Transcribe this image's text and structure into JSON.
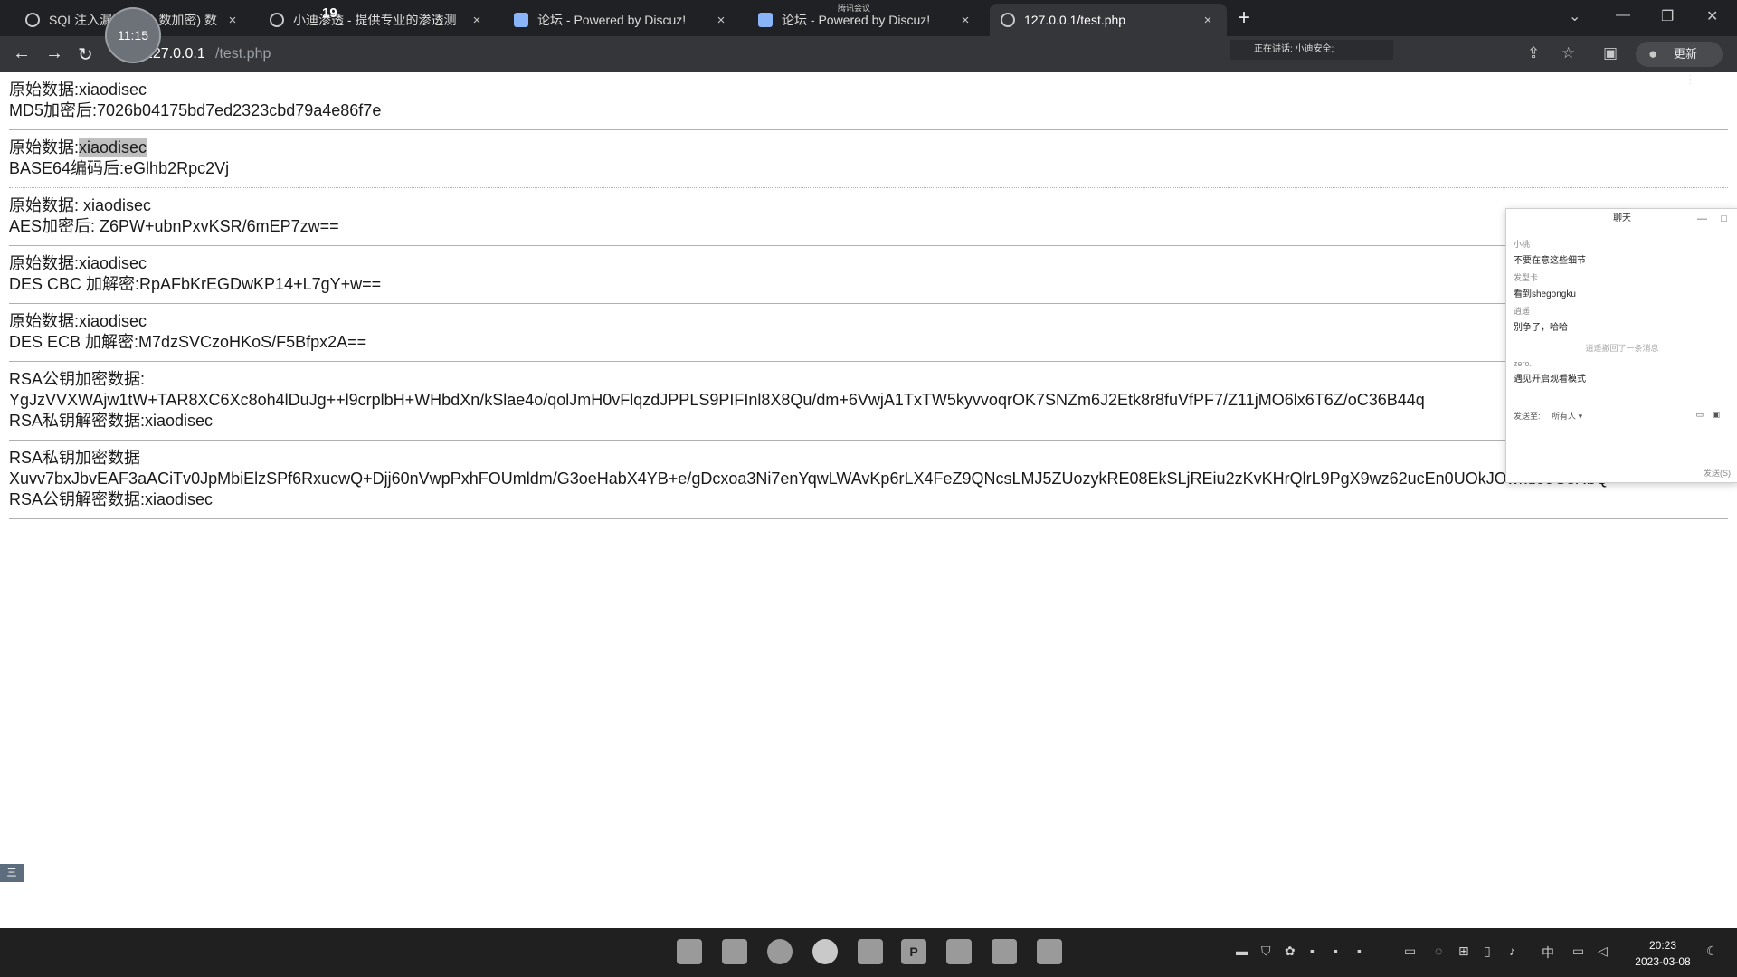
{
  "browser": {
    "tabs": [
      {
        "title": "SQL注入漏洞",
        "title_tail": "数加密) 数"
      },
      {
        "title": "小迪渗透 - 提供专业的渗透测"
      },
      {
        "title": "论坛 - Powered by Discuz!"
      },
      {
        "title": "论坛 - Powered by Discuz!"
      },
      {
        "title": "127.0.0.1/test.php"
      }
    ],
    "close_glyph": "×",
    "new_tab_glyph": "+",
    "url_host": "127.0.0.1",
    "url_path": "/test.php",
    "update_label": "更新",
    "meeting_text": "正在讲话: 小迪安全;",
    "sharing_text": "腾讯会议",
    "timer": "11:15",
    "notification_count": "19"
  },
  "records": [
    {
      "lines": [
        "原始数据:xiaodisec",
        "MD5加密后:7026b04175bd7ed2323cbd79a4e86f7e"
      ]
    },
    {
      "label": "原始数据:",
      "highlight": "xiaodisec",
      "lines2": [
        "BASE64编码后:eGlhb2Rpc2Vj"
      ]
    },
    {
      "lines": [
        "原始数据: xiaodisec",
        "AES加密后: Z6PW+ubnPxvKSR/6mEP7zw=="
      ]
    },
    {
      "lines": [
        "原始数据:xiaodisec",
        "DES CBC 加解密:RpAFbKrEGDwKP14+L7gY+w=="
      ]
    },
    {
      "lines": [
        "原始数据:xiaodisec",
        "DES ECB 加解密:M7dzSVCzoHKoS/F5Bfpx2A=="
      ]
    },
    {
      "lines": [
        "RSA公钥加密数据:",
        "YgJzVVXWAjw1tW+TAR8XC6Xc8oh4lDuJg++l9crplbH+WHbdXn/kSlae4o/qolJmH0vFlqzdJPPLS9PIFInl8X8Qu/dm+6VwjA1TxTW5kyvvoqrOK7SNZm6J2Etk8r8fuVfPF7/Z11jMO6lx6T6Z/oC36B44q",
        "RSA私钥解密数据:xiaodisec"
      ]
    },
    {
      "lines": [
        "RSA私钥加密数据",
        "Xuvv7bxJbvEAF3aACiTv0JpMbiElzSPf6RxucwQ+Djj60nVwpPxhFOUmldm/G3oeHabX4YB+e/gDcxoa3Ni7enYqwLWAvKp6rLX4FeZ9QNcsLMJ5ZUozykRE08EkSLjREiu2zKvKHrQlrL9PgX9wz62ucEn0UOkJOwkdo9GsRbQ=",
        "RSA公钥解密数据:xiaodisec"
      ]
    }
  ],
  "chat": {
    "title": "聊天",
    "messages": [
      {
        "name": "小桃",
        "text": "不要在意这些细节"
      },
      {
        "name": "发型卡",
        "text": "看到shegongku"
      },
      {
        "name": "逍遥",
        "text": "别争了，哈哈"
      },
      {
        "name": "zero.",
        "text": "遇见开启观看模式"
      }
    ],
    "system_note": "逍遥撤回了一条消息",
    "send_to_label": "发送至:",
    "send_to_value": "所有人",
    "send_label": "发送(S)"
  },
  "side_tab": "三",
  "taskbar": {
    "apps": [
      "",
      "",
      "",
      "",
      "",
      "P",
      "",
      "",
      ""
    ],
    "tray_lang": "中",
    "time": "20:23",
    "date": "2023-03-08"
  }
}
